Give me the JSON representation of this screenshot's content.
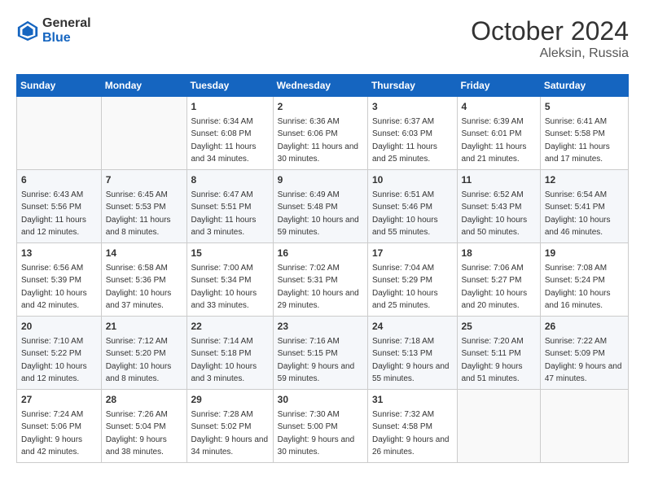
{
  "header": {
    "logo_line1": "General",
    "logo_line2": "Blue",
    "month": "October 2024",
    "location": "Aleksin, Russia"
  },
  "days_of_week": [
    "Sunday",
    "Monday",
    "Tuesday",
    "Wednesday",
    "Thursday",
    "Friday",
    "Saturday"
  ],
  "weeks": [
    [
      {
        "day": "",
        "empty": true
      },
      {
        "day": "",
        "empty": true
      },
      {
        "day": "1",
        "sunrise": "Sunrise: 6:34 AM",
        "sunset": "Sunset: 6:08 PM",
        "daylight": "Daylight: 11 hours and 34 minutes."
      },
      {
        "day": "2",
        "sunrise": "Sunrise: 6:36 AM",
        "sunset": "Sunset: 6:06 PM",
        "daylight": "Daylight: 11 hours and 30 minutes."
      },
      {
        "day": "3",
        "sunrise": "Sunrise: 6:37 AM",
        "sunset": "Sunset: 6:03 PM",
        "daylight": "Daylight: 11 hours and 25 minutes."
      },
      {
        "day": "4",
        "sunrise": "Sunrise: 6:39 AM",
        "sunset": "Sunset: 6:01 PM",
        "daylight": "Daylight: 11 hours and 21 minutes."
      },
      {
        "day": "5",
        "sunrise": "Sunrise: 6:41 AM",
        "sunset": "Sunset: 5:58 PM",
        "daylight": "Daylight: 11 hours and 17 minutes."
      }
    ],
    [
      {
        "day": "6",
        "sunrise": "Sunrise: 6:43 AM",
        "sunset": "Sunset: 5:56 PM",
        "daylight": "Daylight: 11 hours and 12 minutes."
      },
      {
        "day": "7",
        "sunrise": "Sunrise: 6:45 AM",
        "sunset": "Sunset: 5:53 PM",
        "daylight": "Daylight: 11 hours and 8 minutes."
      },
      {
        "day": "8",
        "sunrise": "Sunrise: 6:47 AM",
        "sunset": "Sunset: 5:51 PM",
        "daylight": "Daylight: 11 hours and 3 minutes."
      },
      {
        "day": "9",
        "sunrise": "Sunrise: 6:49 AM",
        "sunset": "Sunset: 5:48 PM",
        "daylight": "Daylight: 10 hours and 59 minutes."
      },
      {
        "day": "10",
        "sunrise": "Sunrise: 6:51 AM",
        "sunset": "Sunset: 5:46 PM",
        "daylight": "Daylight: 10 hours and 55 minutes."
      },
      {
        "day": "11",
        "sunrise": "Sunrise: 6:52 AM",
        "sunset": "Sunset: 5:43 PM",
        "daylight": "Daylight: 10 hours and 50 minutes."
      },
      {
        "day": "12",
        "sunrise": "Sunrise: 6:54 AM",
        "sunset": "Sunset: 5:41 PM",
        "daylight": "Daylight: 10 hours and 46 minutes."
      }
    ],
    [
      {
        "day": "13",
        "sunrise": "Sunrise: 6:56 AM",
        "sunset": "Sunset: 5:39 PM",
        "daylight": "Daylight: 10 hours and 42 minutes."
      },
      {
        "day": "14",
        "sunrise": "Sunrise: 6:58 AM",
        "sunset": "Sunset: 5:36 PM",
        "daylight": "Daylight: 10 hours and 37 minutes."
      },
      {
        "day": "15",
        "sunrise": "Sunrise: 7:00 AM",
        "sunset": "Sunset: 5:34 PM",
        "daylight": "Daylight: 10 hours and 33 minutes."
      },
      {
        "day": "16",
        "sunrise": "Sunrise: 7:02 AM",
        "sunset": "Sunset: 5:31 PM",
        "daylight": "Daylight: 10 hours and 29 minutes."
      },
      {
        "day": "17",
        "sunrise": "Sunrise: 7:04 AM",
        "sunset": "Sunset: 5:29 PM",
        "daylight": "Daylight: 10 hours and 25 minutes."
      },
      {
        "day": "18",
        "sunrise": "Sunrise: 7:06 AM",
        "sunset": "Sunset: 5:27 PM",
        "daylight": "Daylight: 10 hours and 20 minutes."
      },
      {
        "day": "19",
        "sunrise": "Sunrise: 7:08 AM",
        "sunset": "Sunset: 5:24 PM",
        "daylight": "Daylight: 10 hours and 16 minutes."
      }
    ],
    [
      {
        "day": "20",
        "sunrise": "Sunrise: 7:10 AM",
        "sunset": "Sunset: 5:22 PM",
        "daylight": "Daylight: 10 hours and 12 minutes."
      },
      {
        "day": "21",
        "sunrise": "Sunrise: 7:12 AM",
        "sunset": "Sunset: 5:20 PM",
        "daylight": "Daylight: 10 hours and 8 minutes."
      },
      {
        "day": "22",
        "sunrise": "Sunrise: 7:14 AM",
        "sunset": "Sunset: 5:18 PM",
        "daylight": "Daylight: 10 hours and 3 minutes."
      },
      {
        "day": "23",
        "sunrise": "Sunrise: 7:16 AM",
        "sunset": "Sunset: 5:15 PM",
        "daylight": "Daylight: 9 hours and 59 minutes."
      },
      {
        "day": "24",
        "sunrise": "Sunrise: 7:18 AM",
        "sunset": "Sunset: 5:13 PM",
        "daylight": "Daylight: 9 hours and 55 minutes."
      },
      {
        "day": "25",
        "sunrise": "Sunrise: 7:20 AM",
        "sunset": "Sunset: 5:11 PM",
        "daylight": "Daylight: 9 hours and 51 minutes."
      },
      {
        "day": "26",
        "sunrise": "Sunrise: 7:22 AM",
        "sunset": "Sunset: 5:09 PM",
        "daylight": "Daylight: 9 hours and 47 minutes."
      }
    ],
    [
      {
        "day": "27",
        "sunrise": "Sunrise: 7:24 AM",
        "sunset": "Sunset: 5:06 PM",
        "daylight": "Daylight: 9 hours and 42 minutes."
      },
      {
        "day": "28",
        "sunrise": "Sunrise: 7:26 AM",
        "sunset": "Sunset: 5:04 PM",
        "daylight": "Daylight: 9 hours and 38 minutes."
      },
      {
        "day": "29",
        "sunrise": "Sunrise: 7:28 AM",
        "sunset": "Sunset: 5:02 PM",
        "daylight": "Daylight: 9 hours and 34 minutes."
      },
      {
        "day": "30",
        "sunrise": "Sunrise: 7:30 AM",
        "sunset": "Sunset: 5:00 PM",
        "daylight": "Daylight: 9 hours and 30 minutes."
      },
      {
        "day": "31",
        "sunrise": "Sunrise: 7:32 AM",
        "sunset": "Sunset: 4:58 PM",
        "daylight": "Daylight: 9 hours and 26 minutes."
      },
      {
        "day": "",
        "empty": true
      },
      {
        "day": "",
        "empty": true
      }
    ]
  ]
}
